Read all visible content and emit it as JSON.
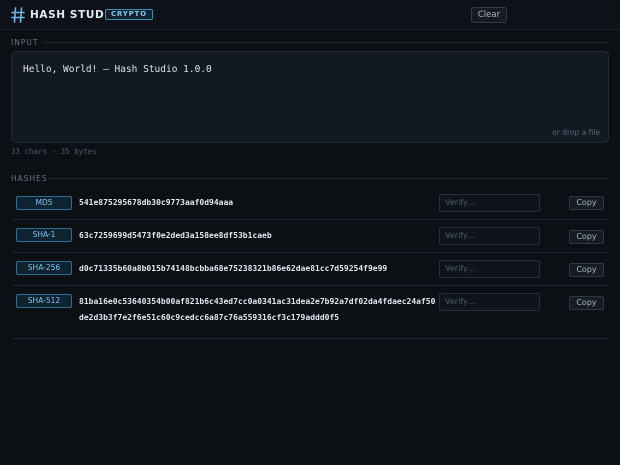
{
  "header": {
    "title": "HASH STUDIO",
    "badge": "CRYPTO",
    "clear_label": "Clear",
    "logo_icon": "hash-icon",
    "accent_color": "#6fb6e6"
  },
  "input": {
    "section_label": "INPUT",
    "value": "Hello, World! — Hash Studio 1.0.0",
    "drop_hint": "or drop a file",
    "stats": "33 chars · 35 bytes"
  },
  "hashes": {
    "section_label": "HASHES",
    "verify_placeholder": "Verify…",
    "copy_label": "Copy",
    "rows": [
      {
        "algo": "MD5",
        "value": "541e875295678db30c9773aaf0d94aaa"
      },
      {
        "algo": "SHA-1",
        "value": "63c7259699d5473f0e2ded3a158ee8df53b1caeb"
      },
      {
        "algo": "SHA-256",
        "value": "d0c71335b60a8b015b74148bcbba68e75238321b86e62dae81cc7d59254f9e99"
      },
      {
        "algo": "SHA-512",
        "value": "81ba16e0c53640354b00af821b6c43ed7cc0a0341ac31dea2e7b92a7df02da4fdaec24af50de2d3b3f7e2f6e51c60c9cedcc6a87c76a559316cf3c179addd0f5"
      }
    ]
  }
}
